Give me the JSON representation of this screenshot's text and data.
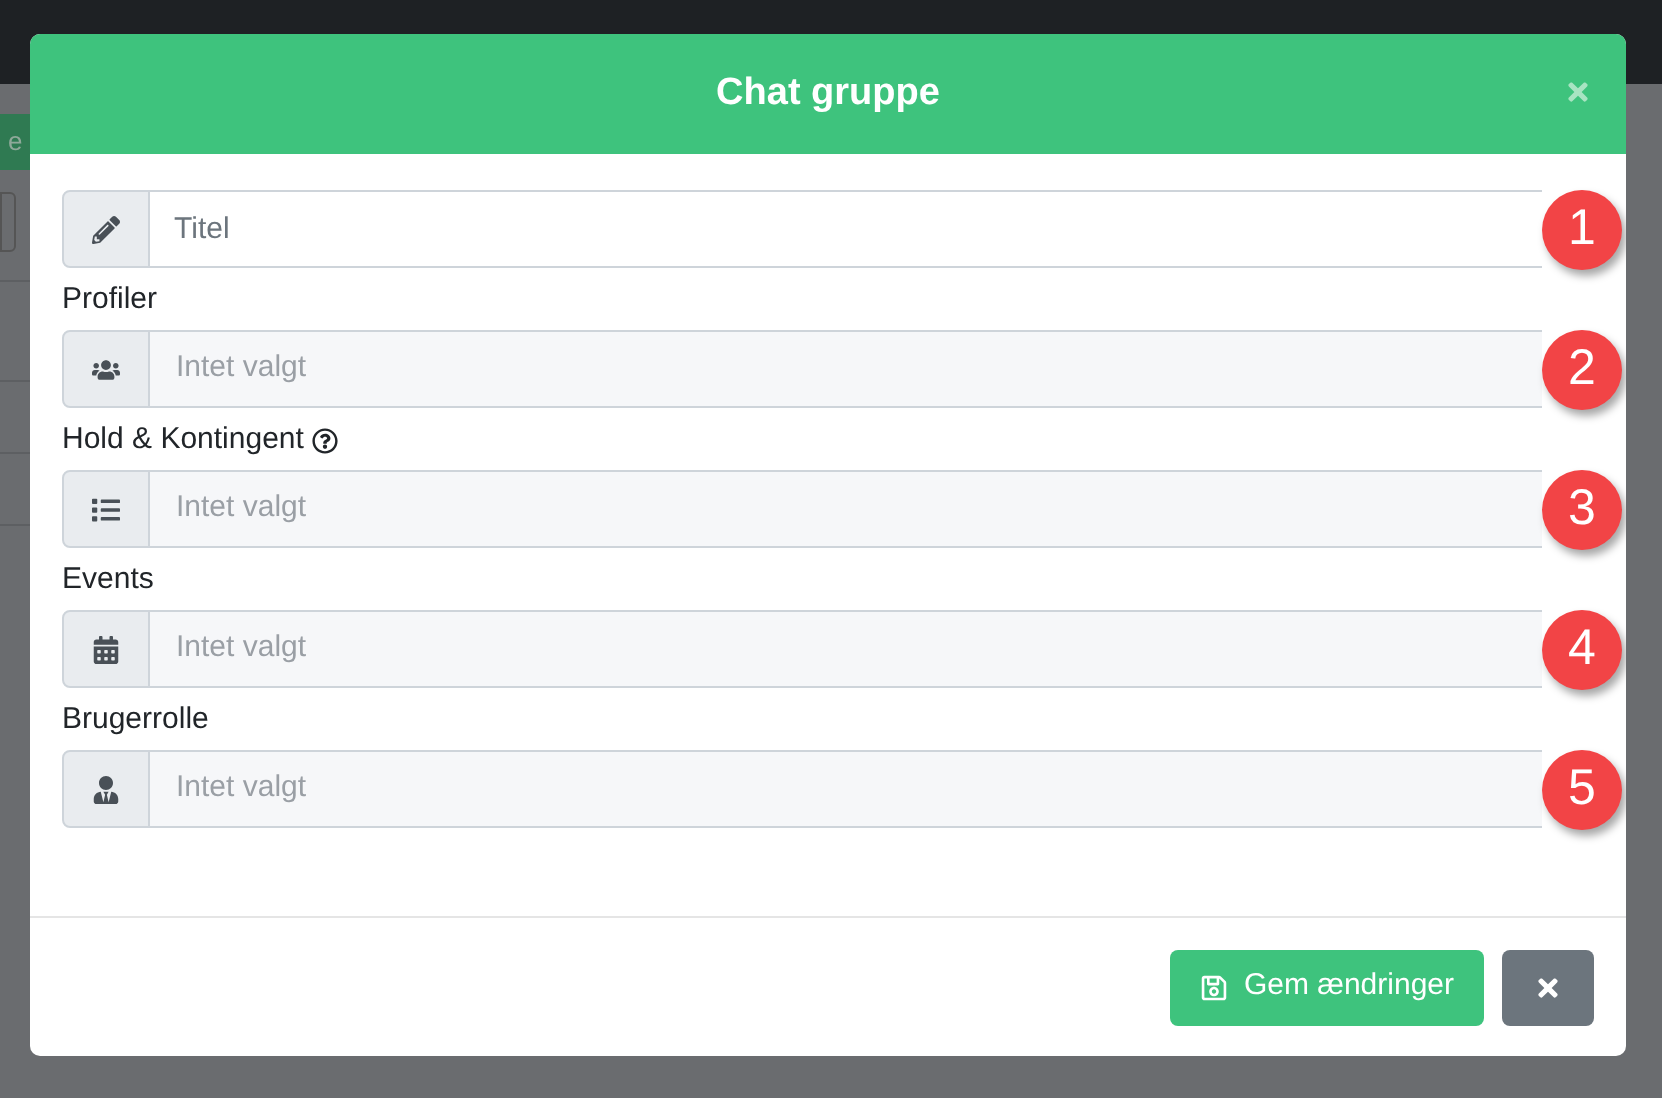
{
  "background": {
    "tab_label": "e"
  },
  "modal": {
    "title": "Chat gruppe",
    "fields": [
      {
        "kind": "input",
        "placeholder": "Titel",
        "badge": "1"
      },
      {
        "kind": "select",
        "label": "Profiler",
        "placeholder": "Intet valgt",
        "badge": "2"
      },
      {
        "kind": "select",
        "label": "Hold & Kontingent",
        "help": true,
        "placeholder": "Intet valgt",
        "badge": "3"
      },
      {
        "kind": "select",
        "label": "Events",
        "placeholder": "Intet valgt",
        "badge": "4"
      },
      {
        "kind": "select",
        "label": "Brugerrolle",
        "placeholder": "Intet valgt",
        "badge": "5"
      }
    ],
    "save_button": "Gem ændringer"
  }
}
